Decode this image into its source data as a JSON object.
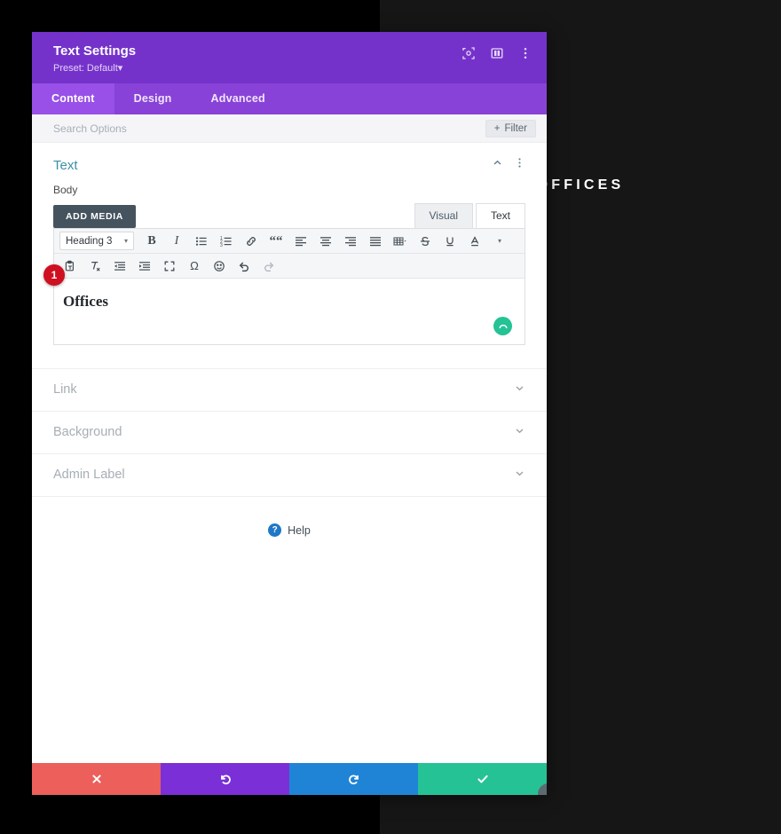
{
  "canvas": {
    "heading_text": "OFFICES",
    "bg_left_color": "#000000",
    "bg_right_color": "#161616"
  },
  "panel": {
    "title": "Text Settings",
    "preset": "Preset: Default",
    "preset_caret": "▾",
    "header_color": "#7532cb",
    "header_icons": [
      {
        "name": "focus-target-icon"
      },
      {
        "name": "panel-layout-icon"
      },
      {
        "name": "more-vertical-icon"
      }
    ],
    "tabs": [
      {
        "label": "Content",
        "active": true
      },
      {
        "label": "Design",
        "active": false
      },
      {
        "label": "Advanced",
        "active": false
      }
    ],
    "search": {
      "placeholder": "Search Options",
      "value": ""
    },
    "filter_button": {
      "label": "Filter",
      "plus": "+"
    }
  },
  "text_section": {
    "title": "Text",
    "collapse_icon": "chevron-up-icon",
    "menu_icon": "more-vertical-icon",
    "body_label": "Body",
    "add_media_label": "ADD MEDIA",
    "editor_tabs": [
      {
        "label": "Visual",
        "active": false
      },
      {
        "label": "Text",
        "active": true
      }
    ],
    "format_select": {
      "value": "Heading 3",
      "caret": "▾"
    },
    "toolbar_row1": [
      {
        "name": "bold-icon",
        "glyph": "B"
      },
      {
        "name": "italic-icon",
        "glyph": "I"
      },
      {
        "name": "bullet-list-icon",
        "glyph": ""
      },
      {
        "name": "numbered-list-icon",
        "glyph": ""
      },
      {
        "name": "link-icon",
        "glyph": ""
      },
      {
        "name": "blockquote-icon",
        "glyph": "“"
      },
      {
        "name": "align-left-icon",
        "glyph": ""
      },
      {
        "name": "align-center-icon",
        "glyph": ""
      },
      {
        "name": "align-right-icon",
        "glyph": ""
      },
      {
        "name": "align-justify-icon",
        "glyph": ""
      },
      {
        "name": "table-icon",
        "glyph": ""
      },
      {
        "name": "strikethrough-icon",
        "glyph": "S"
      },
      {
        "name": "underline-icon",
        "glyph": "U"
      },
      {
        "name": "text-color-icon",
        "glyph": "A"
      }
    ],
    "toolbar_row2": [
      {
        "name": "paste-as-text-icon"
      },
      {
        "name": "clear-formatting-icon"
      },
      {
        "name": "outdent-icon"
      },
      {
        "name": "indent-icon"
      },
      {
        "name": "fullscreen-icon"
      },
      {
        "name": "special-character-icon",
        "glyph": "Ω"
      },
      {
        "name": "emoji-icon"
      },
      {
        "name": "undo-icon"
      },
      {
        "name": "redo-icon"
      }
    ],
    "content_value": "Offices",
    "step_badge": "1",
    "save_indicator": "saving-spinner-icon"
  },
  "collapsed_sections": [
    {
      "label": "Link",
      "chevron": "⌄"
    },
    {
      "label": "Background",
      "chevron": "⌄"
    },
    {
      "label": "Admin Label",
      "chevron": "⌄"
    }
  ],
  "help": {
    "label": "Help",
    "icon_glyph": "?"
  },
  "footer": {
    "buttons": [
      {
        "name": "cancel-button",
        "icon": "close-icon",
        "color": "#ec5f5a"
      },
      {
        "name": "undo-button",
        "icon": "undo-icon",
        "color": "#7b2fd6"
      },
      {
        "name": "redo-button",
        "icon": "redo-icon",
        "color": "#1f84d6"
      },
      {
        "name": "save-button",
        "icon": "check-icon",
        "color": "#25c295"
      }
    ],
    "resize_handle": "resize-handle-icon"
  }
}
